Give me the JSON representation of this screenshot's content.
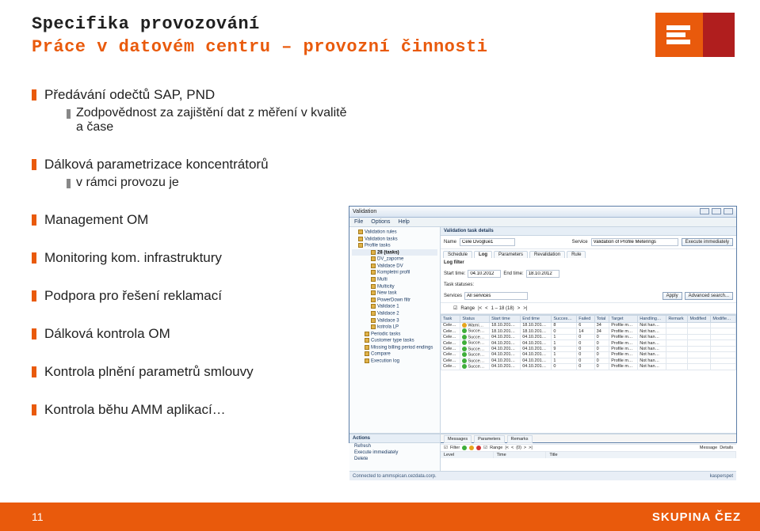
{
  "header": {
    "title1": "Specifika provozování",
    "title2": "Práce v datovém centru – provozní činnosti"
  },
  "bullets": {
    "b1_l1a": "Předávání odečtů SAP, PND",
    "b1_l2a": "Zodpovědnost za zajištění dat z měření v kvalitě a čase",
    "b2_l1a": "Dálková parametrizace koncentrátorů",
    "b2_l2a": "v rámci provozu je",
    "b3_l1a": "Management OM",
    "b4_l1a": "Monitoring kom. infrastruktury",
    "b5_l1a": "Podpora pro řešení reklamací",
    "b6_l1a": "Dálková kontrola OM",
    "b7_l1a": "Kontrola plnění parametrů smlouvy",
    "b8_l1a": "Kontrola běhu AMM aplikací…"
  },
  "screenshot": {
    "window_title": "Validation",
    "menu": [
      "File",
      "Options",
      "Help"
    ],
    "sidebar": {
      "items": [
        "Validation rules",
        "Validation tasks",
        "Profile tasks",
        "28 (tasks)",
        "DV_zaporne",
        "Validace DV",
        "Kompletni profil",
        "Multi",
        "Multicity",
        "New task",
        "PowerDown filtr",
        "Validace 1",
        "Validace 2",
        "Validace 3",
        "kotrola LP",
        "Periodic tasks",
        "Customer type tasks",
        "Missing billing period endings",
        "Compare",
        "Execution log"
      ]
    },
    "main": {
      "panel_title": "Validation task details",
      "name_label": "Name",
      "name_value": "Cele Dvoglue1",
      "service_label": "Service",
      "service_value": "Validation of Profile Meterings",
      "execute_btn": "Execute immediately",
      "tabs": [
        "Schedule",
        "Log",
        "Parameters",
        "Revalidation",
        "Rule"
      ],
      "log_filter_label": "Log filter",
      "starttime_label": "Start time:",
      "starttime_value": "04.10.2012",
      "endtime_label": "End time:",
      "endtime_value": "18.10.2012",
      "taskstatuses_label": "Task statuses:",
      "services_label": "Services",
      "services_value": "All services",
      "apply_btn": "Apply",
      "advsearch_btn": "Advanced search...",
      "range_label": "Range",
      "range_text": "1 – 18 (18)",
      "grid_headers": [
        "Task",
        "Status",
        "Start time",
        "End time",
        "Succes…",
        "Failed",
        "Total",
        "Target",
        "Handling…",
        "Remark",
        "Modified",
        "Modifie…"
      ],
      "rows": [
        {
          "task": "Cele…",
          "status": "Warni…",
          "st": "18.10.201…",
          "et": "18.10.201…",
          "succ": "8",
          "fail": "6",
          "tot": "34",
          "target": "Profile m…",
          "hand": "Not han…",
          "cls": "warn"
        },
        {
          "task": "Cele…",
          "status": "Succe…",
          "st": "18.10.201…",
          "et": "18.10.201…",
          "succ": "0",
          "fail": "14",
          "tot": "34",
          "target": "Profile m…",
          "hand": "Not han…",
          "cls": "ok"
        },
        {
          "task": "Cele…",
          "status": "Succe…",
          "st": "04.10.201…",
          "et": "04.10.201…",
          "succ": "1",
          "fail": "0",
          "tot": "0",
          "target": "Profile m…",
          "hand": "Not han…",
          "cls": "ok"
        },
        {
          "task": "Cele…",
          "status": "Succe…",
          "st": "04.10.201…",
          "et": "04.10.201…",
          "succ": "1",
          "fail": "0",
          "tot": "0",
          "target": "Profile m…",
          "hand": "Not han…",
          "cls": "ok"
        },
        {
          "task": "Cele…",
          "status": "Succe…",
          "st": "04.10.201…",
          "et": "04.10.201…",
          "succ": "9",
          "fail": "0",
          "tot": "0",
          "target": "Profile m…",
          "hand": "Not han…",
          "cls": "ok"
        },
        {
          "task": "Cele…",
          "status": "Succe…",
          "st": "04.10.201…",
          "et": "04.10.201…",
          "succ": "1",
          "fail": "0",
          "tot": "0",
          "target": "Profile m…",
          "hand": "Not han…",
          "cls": "ok"
        },
        {
          "task": "Cele…",
          "status": "Succe…",
          "st": "04.10.201…",
          "et": "04.10.201…",
          "succ": "1",
          "fail": "0",
          "tot": "0",
          "target": "Profile m…",
          "hand": "Not han…",
          "cls": "ok"
        },
        {
          "task": "Cele…",
          "status": "Succe…",
          "st": "04.10.201…",
          "et": "04.10.201…",
          "succ": "0",
          "fail": "0",
          "tot": "0",
          "target": "Profile m…",
          "hand": "Not han…",
          "cls": "ok"
        }
      ]
    },
    "actions": {
      "title": "Actions",
      "items": [
        "Refresh",
        "Execute immediately",
        "Delete"
      ]
    },
    "messages": {
      "tabs": [
        "Messages",
        "Parameters",
        "Remarks"
      ],
      "filter_label": "Filter",
      "range_label": "Range",
      "range_text": "(0)",
      "headers": [
        "Level",
        "Time",
        "Title"
      ],
      "details_btn": "Details",
      "message_label": "Message"
    },
    "status": {
      "left": "Connected to ammspican.cezdata.corp.",
      "right": "kasperspet"
    }
  },
  "footer": {
    "page": "11",
    "brand": "SKUPINA ČEZ"
  }
}
